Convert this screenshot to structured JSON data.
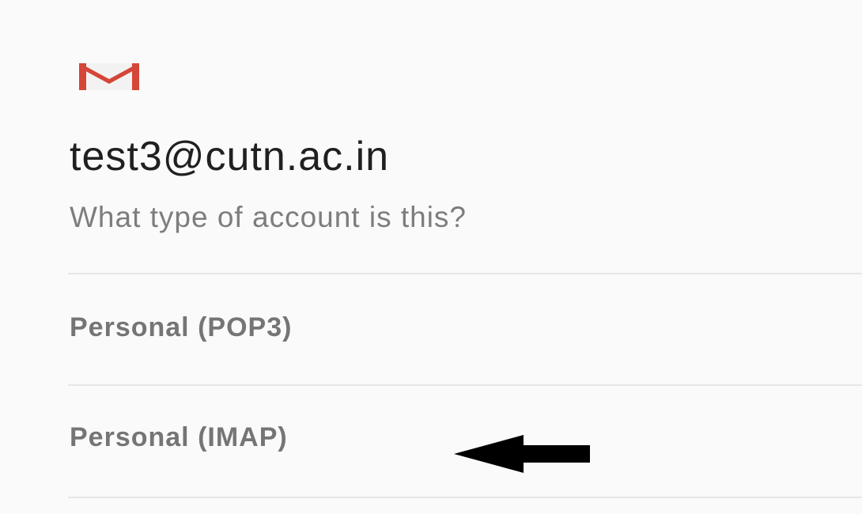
{
  "header": {
    "logo_icon": "gmail-icon",
    "account_email": "test3@cutn.ac.in",
    "prompt": "What type of account is this?"
  },
  "account_types": [
    {
      "label": "Personal (POP3)"
    },
    {
      "label": "Personal (IMAP)"
    }
  ],
  "annotation": {
    "arrow_icon": "left-arrow-icon",
    "points_to": "Personal (IMAP)"
  },
  "colors": {
    "background": "#fafafa",
    "gmail_red": "#d44638",
    "gmail_dark_red": "#b23121",
    "email_text": "#202020",
    "secondary_text": "#7d7d7d",
    "option_text": "#757575",
    "divider": "#e6e6e6",
    "arrow": "#000000"
  }
}
